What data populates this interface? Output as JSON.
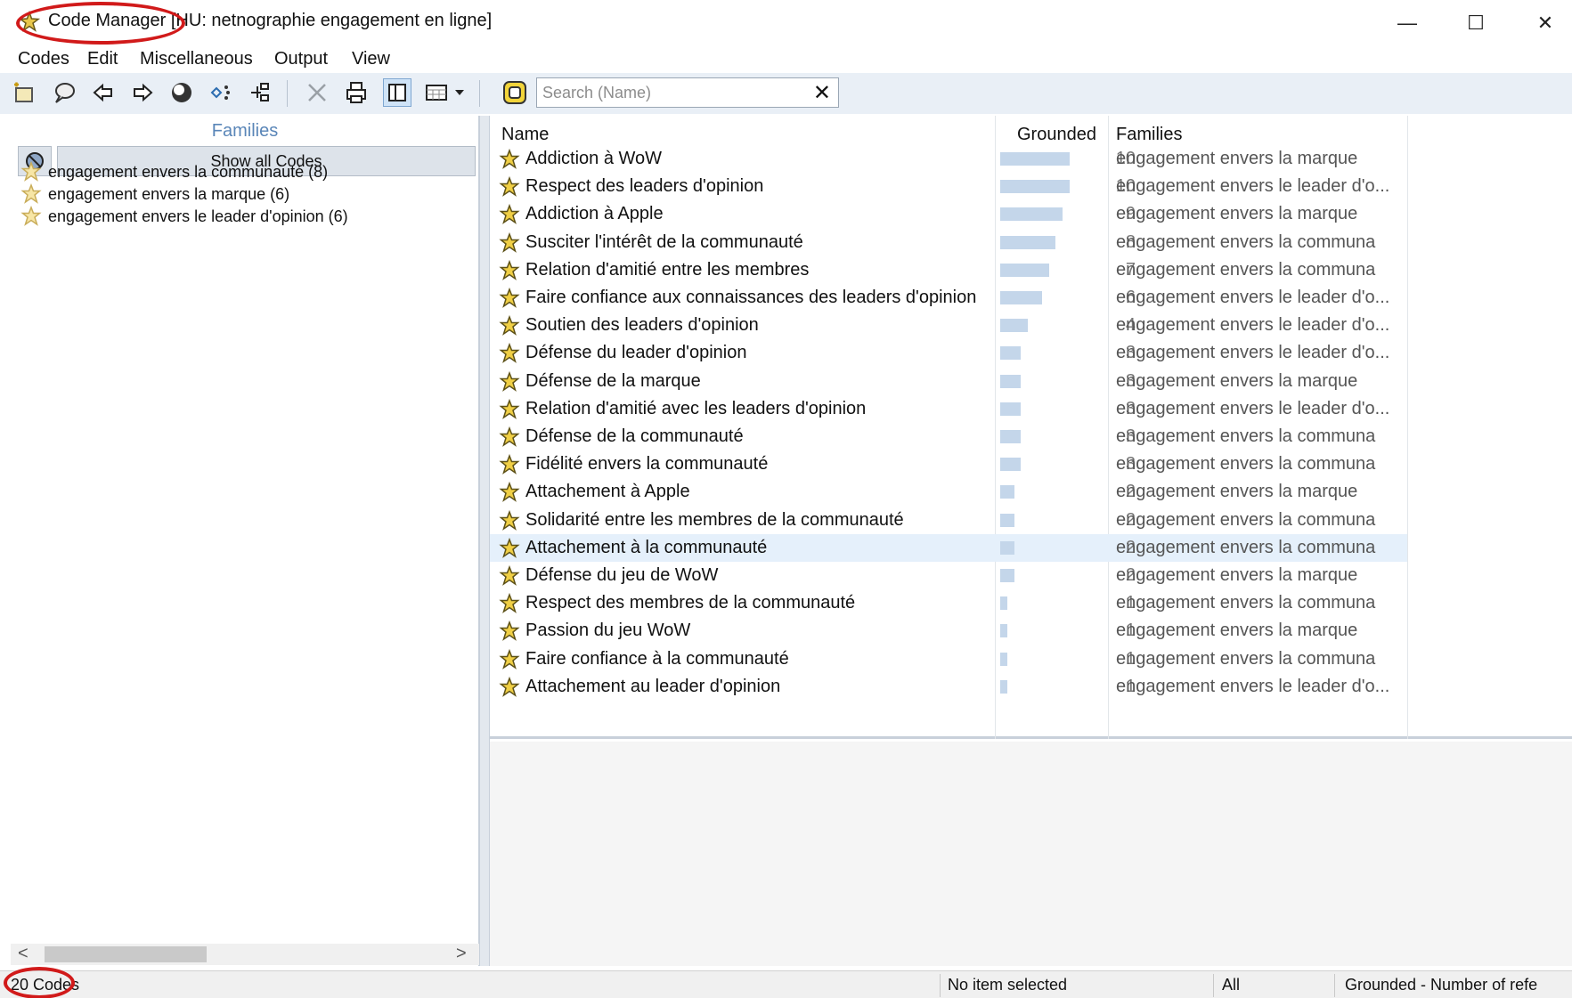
{
  "window": {
    "app_name": "Code Manager",
    "title_suffix": "[HU: netnographie engagement en ligne]",
    "minimize": "—",
    "maximize": "☐",
    "close": "✕"
  },
  "menu": [
    "Codes",
    "Edit",
    "Miscellaneous",
    "Output",
    "View"
  ],
  "toolbar": {
    "icons": [
      "new-code-icon",
      "comment-icon",
      "back-arrow-icon",
      "forward-arrow-icon",
      "globe-icon",
      "network-icon",
      "tree-icon",
      "delete-icon",
      "print-icon",
      "panel-toggle-icon",
      "grid-view-icon",
      "dropdown-arrow-icon"
    ],
    "filter_icon": "code-filter-icon",
    "search_placeholder": "Search (Name)",
    "search_value": "",
    "search_clear": "✕"
  },
  "families_panel": {
    "header": "Families",
    "show_all_label": "Show all Codes",
    "items": [
      {
        "label": "engagement envers la communauté (8)"
      },
      {
        "label": "engagement envers la marque (6)"
      },
      {
        "label": "engagement envers le leader d'opinion (6)"
      }
    ],
    "scroll_left": "<",
    "scroll_right": ">"
  },
  "table": {
    "columns": [
      "Name",
      "Grounded",
      "Families"
    ],
    "max_grounded": 10,
    "rows": [
      {
        "name": "Addiction à WoW",
        "grounded": 10,
        "families": "engagement envers la marque"
      },
      {
        "name": "Respect des leaders d'opinion",
        "grounded": 10,
        "families": "engagement envers le leader d'o..."
      },
      {
        "name": "Addiction à Apple",
        "grounded": 9,
        "families": "engagement envers la marque"
      },
      {
        "name": "Susciter l'intérêt de la communauté",
        "grounded": 8,
        "families": "engagement envers la communa"
      },
      {
        "name": "Relation d'amitié entre les membres",
        "grounded": 7,
        "families": "engagement envers la communa"
      },
      {
        "name": "Faire confiance aux connaissances des leaders d'opinion",
        "grounded": 6,
        "families": "engagement envers le leader d'o..."
      },
      {
        "name": "Soutien des leaders d'opinion",
        "grounded": 4,
        "families": "engagement envers le leader d'o..."
      },
      {
        "name": "Défense  du leader d'opinion",
        "grounded": 3,
        "families": "engagement envers le leader d'o..."
      },
      {
        "name": "Défense de la marque",
        "grounded": 3,
        "families": "engagement envers la marque"
      },
      {
        "name": "Relation d'amitié avec les leaders d'opinion",
        "grounded": 3,
        "families": "engagement envers le leader d'o..."
      },
      {
        "name": "Défense de la communauté",
        "grounded": 3,
        "families": "engagement envers la communa"
      },
      {
        "name": "Fidélité envers la communauté",
        "grounded": 3,
        "families": "engagement envers la communa"
      },
      {
        "name": "Attachement à Apple",
        "grounded": 2,
        "families": "engagement envers la marque"
      },
      {
        "name": "Solidarité entre les membres de la communauté",
        "grounded": 2,
        "families": "engagement envers la communa"
      },
      {
        "name": "Attachement à la communauté",
        "grounded": 2,
        "families": "engagement envers la communa",
        "selected": true
      },
      {
        "name": "Défense du jeu de WoW",
        "grounded": 2,
        "families": "engagement envers la marque"
      },
      {
        "name": "Respect des membres de la communauté",
        "grounded": 1,
        "families": "engagement envers la communa"
      },
      {
        "name": "Passion du jeu WoW",
        "grounded": 1,
        "families": "engagement envers la marque"
      },
      {
        "name": "Faire confiance à la communauté",
        "grounded": 1,
        "families": "engagement envers la communa"
      },
      {
        "name": "Attachement au leader d'opinion",
        "grounded": 1,
        "families": "engagement envers le leader d'o..."
      }
    ]
  },
  "statusbar": {
    "count": "20 Codes",
    "selection": "No item selected",
    "filter": "All",
    "sort": "Grounded - Number of refe"
  },
  "colors": {
    "annotation": "#d11a1a",
    "bar": "#c4d6ea",
    "families_header": "#5a86b8",
    "toolbar_bg": "#e9eff6"
  }
}
